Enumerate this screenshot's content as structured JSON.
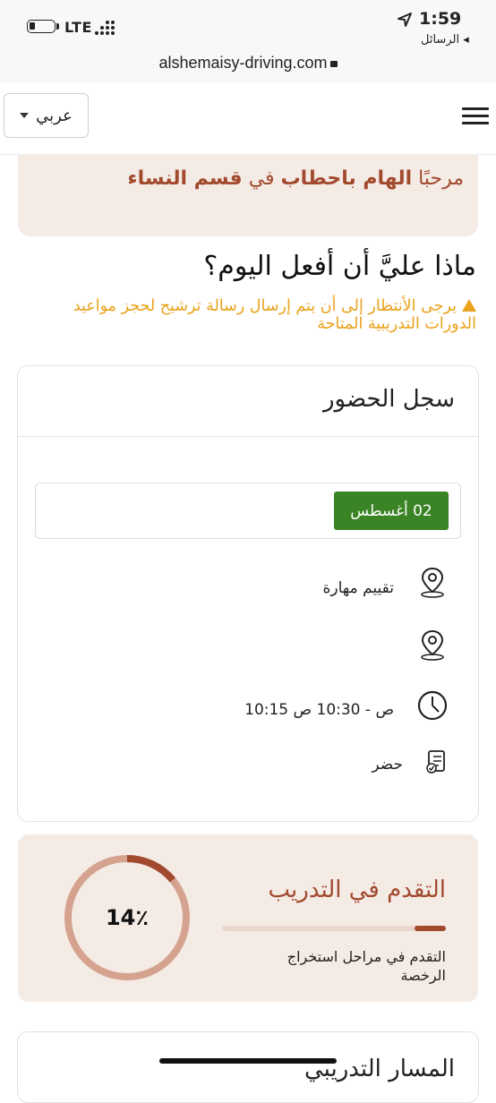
{
  "status_bar": {
    "carrier": "LTE",
    "time": "1:59",
    "back_app": "الرسائل"
  },
  "browser": {
    "url": "alshemaisy-driving.com"
  },
  "nav": {
    "language_label": "عربي"
  },
  "welcome": {
    "greeting": "مرحبًا",
    "name": "الهام باحطاب",
    "in": "في",
    "section": "قسم النساء"
  },
  "page_question": "ماذا عليَّ أن أفعل اليوم؟",
  "notice": "يرجى الأنتظار إلى أن يتم إرسال رسالة ترشيح لحجز مواعيد الدورات التدريبية المتاحة",
  "attendance": {
    "title": "سجل الحضور",
    "date_badge": "02 أغسطس",
    "items": [
      {
        "icon": "map-pin-icon",
        "text": "تقييم مهارة"
      },
      {
        "icon": "map-pin-icon",
        "text": ""
      },
      {
        "icon": "clock-icon",
        "text": "10:15 ص - 10:30 ص"
      },
      {
        "icon": "checklist-icon",
        "text": "حضر"
      }
    ]
  },
  "progress": {
    "title": "التقدم في التدريب",
    "percent_label": "14٪",
    "percent_value": 0.14,
    "subtitle": "التقدم في مراحل استخراج الرخصة"
  },
  "next_section": {
    "title": "المسار التدريبي"
  },
  "colors": {
    "brand": "#a24a2e",
    "welcome_bg": "#f5ebe5",
    "badge_green": "#3b8426",
    "warning": "#e9a21b",
    "ring_track": "#d4a28f"
  }
}
